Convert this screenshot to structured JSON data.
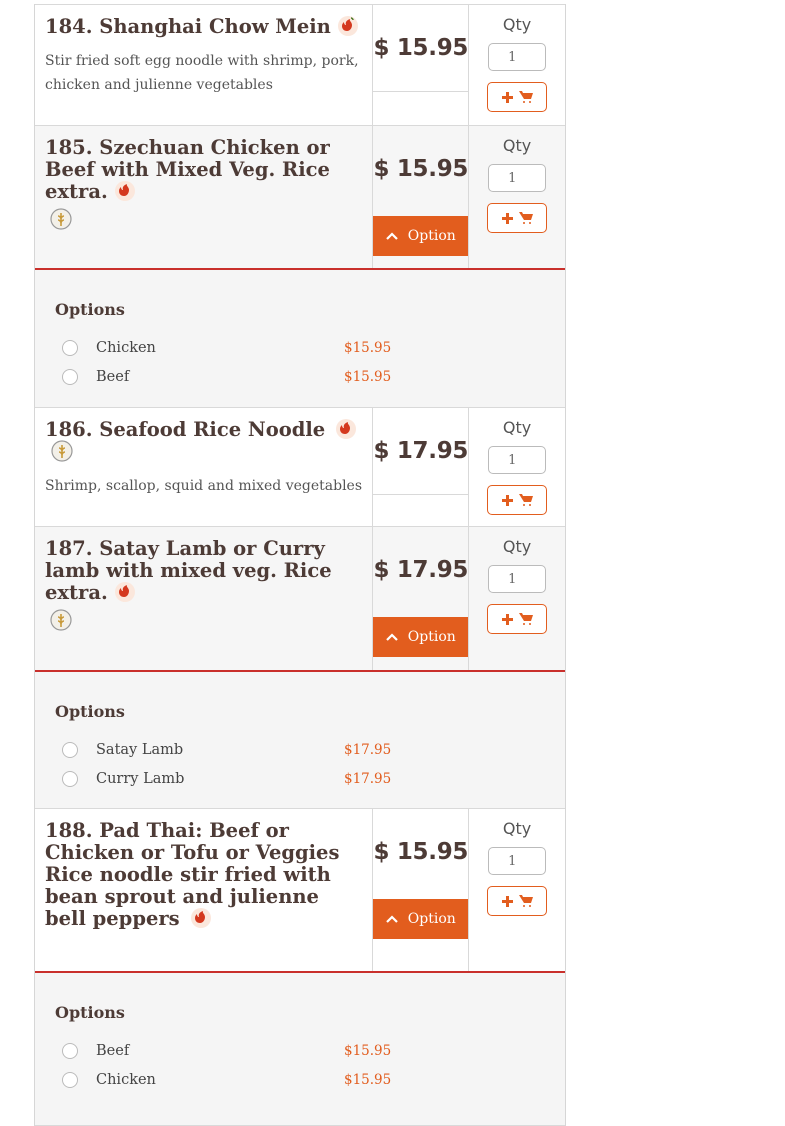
{
  "qty_label": "Qty",
  "option_button_label": "Option",
  "options_heading": "Options",
  "currency_symbol": "$",
  "colors": {
    "accent": "#e25d1e",
    "title": "#4d3b36",
    "divider_open": "#c9302c"
  },
  "items": [
    {
      "title": "184. Shanghai Chow Mein",
      "description": "Stir fried soft egg noodle with shrimp, pork, chicken and julienne vegetables",
      "price": "$ 15.95",
      "qty": "1",
      "icons": [
        "chili-icon"
      ]
    },
    {
      "title": "185. Szechuan Chicken or Beef with Mixed Veg. Rice extra.",
      "price": "$ 15.95",
      "qty": "1",
      "icons": [
        "chili-icon",
        "wheat-icon"
      ],
      "options": [
        {
          "name": "Chicken",
          "price": "$15.95"
        },
        {
          "name": "Beef",
          "price": "$15.95"
        }
      ]
    },
    {
      "title": "186. Seafood Rice Noodle",
      "description": "Shrimp, scallop, squid and mixed vegetables",
      "price": "$ 17.95",
      "qty": "1",
      "icons": [
        "chili-icon",
        "wheat-icon"
      ]
    },
    {
      "title": "187. Satay Lamb or Curry lamb with mixed veg. Rice extra.",
      "price": "$ 17.95",
      "qty": "1",
      "icons": [
        "chili-icon",
        "wheat-icon"
      ],
      "options": [
        {
          "name": "Satay Lamb",
          "price": "$17.95"
        },
        {
          "name": "Curry Lamb",
          "price": "$17.95"
        }
      ]
    },
    {
      "title": "188. Pad Thai: Beef or Chicken or Tofu or Veggies Rice noodle stir fried with bean sprout and julienne bell peppers",
      "price": "$ 15.95",
      "qty": "1",
      "icons": [
        "chili-icon"
      ],
      "options": [
        {
          "name": "Beef",
          "price": "$15.95"
        },
        {
          "name": "Chicken",
          "price": "$15.95"
        }
      ]
    }
  ]
}
